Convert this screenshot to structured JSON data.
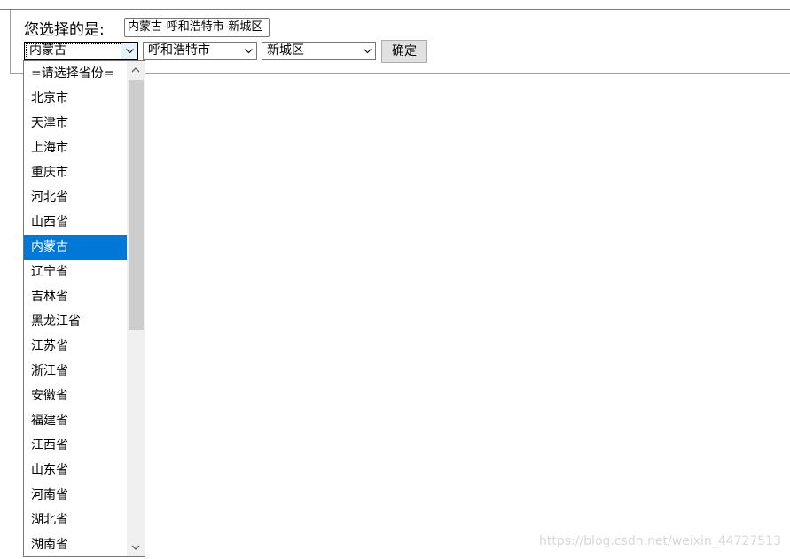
{
  "form": {
    "result_label": "您选择的是:",
    "result_value": "内蒙古-呼和浩特市-新城区",
    "province_select": "内蒙古",
    "city_select": "呼和浩特市",
    "district_select": "新城区",
    "confirm_label": "确定"
  },
  "dropdown": {
    "items": [
      "=请选择省份=",
      "北京市",
      "天津市",
      "上海市",
      "重庆市",
      "河北省",
      "山西省",
      "内蒙古",
      "辽宁省",
      "吉林省",
      "黑龙江省",
      "江苏省",
      "浙江省",
      "安徽省",
      "福建省",
      "江西省",
      "山东省",
      "河南省",
      "湖北省",
      "湖南省"
    ],
    "selected": "内蒙古"
  },
  "watermark": "https://blog.csdn.net/weixin_44727513",
  "colors": {
    "selection": "#0078d7",
    "button_bg": "#e1e1e1"
  }
}
